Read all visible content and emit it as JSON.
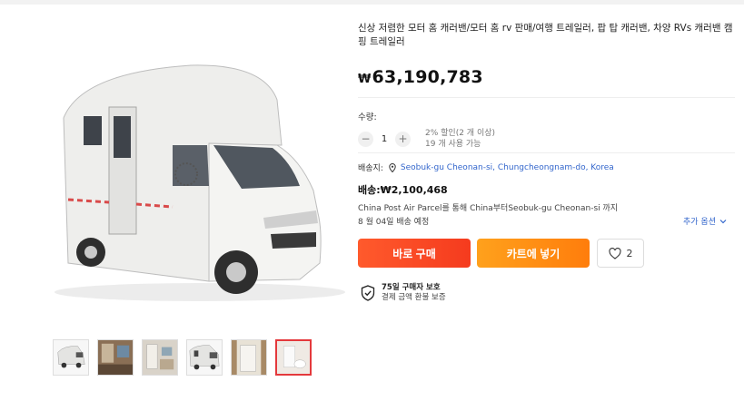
{
  "product": {
    "title": "신상 저렴한 모터 홈 캐러밴/모터 홈 rv 판매/여행 트레일러, 팝 탑 캐러밴, 차양 RVs 캐러밴 캠핑 트레일러",
    "currency_symbol": "₩",
    "price": "63,190,783"
  },
  "quantity": {
    "label": "수량:",
    "value": "1",
    "minus": "−",
    "plus": "+",
    "discount_note": "2% 할인(2 개 이상)",
    "available": "19 개 사용 가능"
  },
  "shipping": {
    "label": "배송지:",
    "location": "Seobuk-gu Cheonan-si, Chungcheongnam-do, Korea",
    "fee": "배송:₩2,100,468",
    "method": "China Post Air Parcel를 통해 China부터Seobuk-gu Cheonan-si 까지",
    "delivery": "8 월 04일 배송 예정",
    "more_options": "추가 옵션"
  },
  "actions": {
    "buy_now": "바로 구매",
    "add_to_cart": "카트에 넣기",
    "wishlist_count": "2"
  },
  "protection": {
    "title": "75일 구매자 보호",
    "subtitle": "결제 금액 환불 보증"
  },
  "icons": {
    "location": "map-pin-icon",
    "wishlist": "heart-icon",
    "protection": "shield-check-icon",
    "more": "chevron-down-icon"
  },
  "colors": {
    "buy_button": "#f53b1e",
    "cart_button": "#ff7d0c",
    "link": "#3366cc",
    "active_thumb_border": "#e4393c"
  }
}
